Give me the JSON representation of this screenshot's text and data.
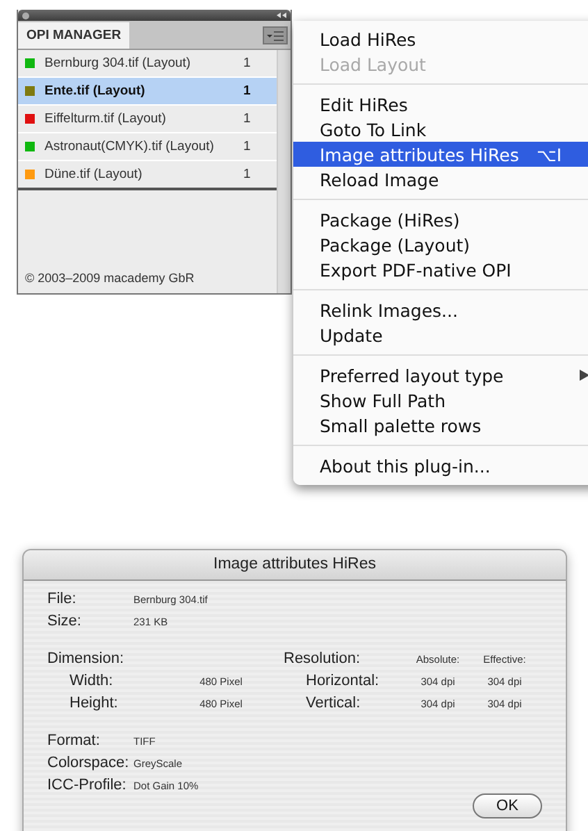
{
  "panel": {
    "tab": {
      "label": "OPI MANAGER",
      "selected": true
    },
    "rows": [
      {
        "name": "Bernburg 304.tif (Layout)",
        "count": "1",
        "color": "#10b810",
        "selected": false
      },
      {
        "name": "Ente.tif (Layout)",
        "count": "1",
        "color": "#7f7a10",
        "selected": true
      },
      {
        "name": "Eiffelturm.tif (Layout)",
        "count": "1",
        "color": "#e01010",
        "selected": false
      },
      {
        "name": "Astronaut(CMYK).tif (Layout)",
        "count": "1",
        "color": "#10b810",
        "selected": false
      },
      {
        "name": "Düne.tif (Layout)",
        "count": "1",
        "color": "#ff9a10",
        "selected": false
      }
    ],
    "footer": "© 2003–2009 macademy GbR"
  },
  "menu": {
    "groups": [
      {
        "items": [
          {
            "label": "Load HiRes",
            "disabled": false,
            "selected": false
          },
          {
            "label": "Load Layout",
            "disabled": true,
            "selected": false
          }
        ]
      },
      {
        "items": [
          {
            "label": "Edit HiRes",
            "disabled": false,
            "selected": false
          },
          {
            "label": "Goto To Link",
            "disabled": false,
            "selected": false
          },
          {
            "label": "Image attributes HiRes",
            "shortcut": "⌥I",
            "disabled": false,
            "selected": true
          },
          {
            "label": "Reload Image",
            "disabled": false,
            "selected": false
          }
        ]
      },
      {
        "items": [
          {
            "label": "Package (HiRes)",
            "disabled": false,
            "selected": false
          },
          {
            "label": "Package (Layout)",
            "disabled": false,
            "selected": false
          },
          {
            "label": "Export PDF-native OPI",
            "disabled": false,
            "selected": false
          }
        ]
      },
      {
        "items": [
          {
            "label": "Relink Images...",
            "disabled": false,
            "selected": false
          },
          {
            "label": "Update",
            "disabled": false,
            "selected": false
          }
        ]
      },
      {
        "items": [
          {
            "label": "Preferred layout type",
            "submenu": true,
            "disabled": false,
            "selected": false
          },
          {
            "label": "Show Full Path",
            "disabled": false,
            "selected": false
          },
          {
            "label": "Small palette rows",
            "disabled": false,
            "selected": false
          }
        ]
      },
      {
        "items": [
          {
            "label": "About this plug-in...",
            "disabled": false,
            "selected": false
          }
        ]
      }
    ]
  },
  "dialog": {
    "title": "Image attributes HiRes",
    "file": {
      "label": "File:",
      "value": "Bernburg 304.tif"
    },
    "size": {
      "label": "Size:",
      "value": "231 KB"
    },
    "dimension": {
      "label": "Dimension:",
      "width": {
        "label": "Width:",
        "value": "480 Pixel"
      },
      "height": {
        "label": "Height:",
        "value": "480 Pixel"
      }
    },
    "resolution": {
      "label": "Resolution:",
      "absolute_header": "Absolute:",
      "effective_header": "Effective:",
      "horizontal": {
        "label": "Horizontal:",
        "absolute": "304 dpi",
        "effective": "304 dpi"
      },
      "vertical": {
        "label": "Vertical:",
        "absolute": "304 dpi",
        "effective": "304 dpi"
      }
    },
    "format": {
      "label": "Format:",
      "value": "TIFF"
    },
    "colorspace": {
      "label": "Colorspace:",
      "value": "GreyScale"
    },
    "icc_profile": {
      "label": "ICC-Profile:",
      "value": "Dot Gain 10%"
    },
    "ok_button": "OK"
  }
}
